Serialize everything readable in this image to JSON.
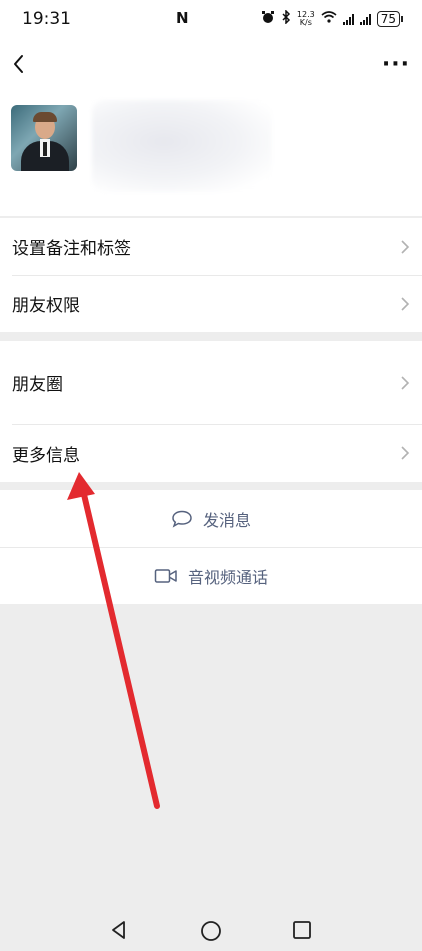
{
  "status_bar": {
    "time": "19:31",
    "nfc": "N",
    "speed_top": "12.3",
    "speed_bottom": "K/s",
    "battery": "75",
    "icons": [
      "alarm-icon",
      "bluetooth-icon",
      "wifi-icon",
      "signal-icon",
      "signal-icon",
      "battery-icon"
    ]
  },
  "header": {
    "back_icon": "chevron-left-icon",
    "more_icon": "more-dots-icon",
    "more_label": "···"
  },
  "menu_group_1": [
    {
      "label": "设置备注和标签"
    },
    {
      "label": "朋友权限"
    }
  ],
  "menu_group_2": [
    {
      "label": "朋友圈"
    },
    {
      "label": "更多信息"
    }
  ],
  "actions": {
    "message_label": "发消息",
    "call_label": "音视频通话",
    "accent_color": "#56627e"
  },
  "annotation": {
    "arrow_color": "#e32a2f"
  },
  "navbar": {
    "icons": [
      "back-triangle-icon",
      "home-circle-icon",
      "recents-square-icon"
    ]
  }
}
